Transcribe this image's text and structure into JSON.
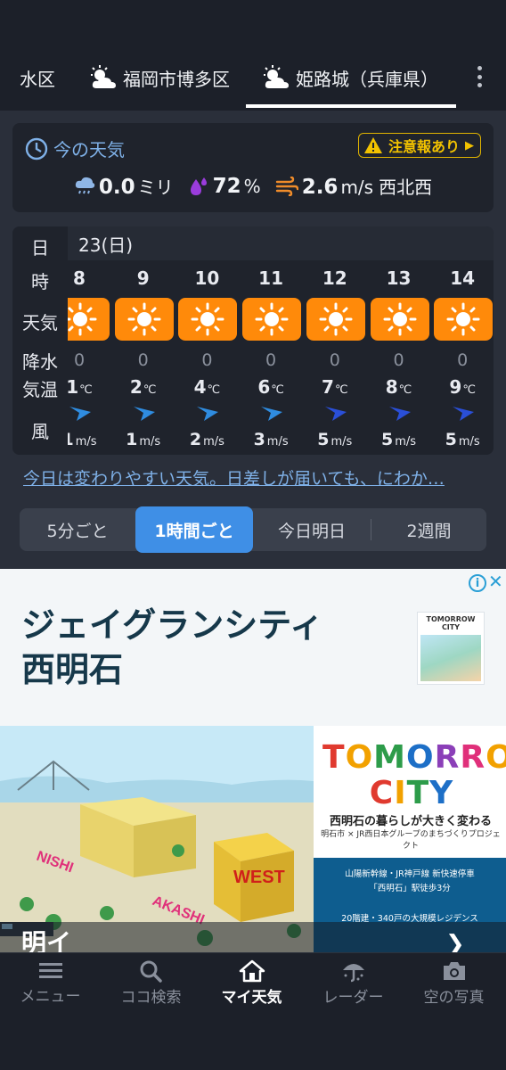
{
  "location_tabs": [
    {
      "label": "水区",
      "has_icon": false
    },
    {
      "label": "福岡市博多区",
      "has_icon": true
    },
    {
      "label": "姫路城（兵庫県）",
      "has_icon": true,
      "active": true
    }
  ],
  "current": {
    "title": "今の天気",
    "alert": "注意報あり",
    "rain_value": "0.0",
    "rain_unit": "ミリ",
    "humidity_value": "72",
    "humidity_unit": "%",
    "wind_value": "2.6",
    "wind_unit": "m/s",
    "wind_dir": "西北西"
  },
  "hourly": {
    "labels": {
      "day": "日",
      "hour": "時",
      "weather": "天気",
      "precip": "降水",
      "temp": "気温",
      "wind": "風"
    },
    "date": "23(日)",
    "temp_unit": "℃",
    "wind_unit": "m/s",
    "columns": [
      {
        "hour": "8",
        "weather": "sunny",
        "precip": "0",
        "temp": "1",
        "wind": "1"
      },
      {
        "hour": "9",
        "weather": "sunny",
        "precip": "0",
        "temp": "2",
        "wind": "1"
      },
      {
        "hour": "10",
        "weather": "sunny",
        "precip": "0",
        "temp": "4",
        "wind": "2"
      },
      {
        "hour": "11",
        "weather": "sunny",
        "precip": "0",
        "temp": "6",
        "wind": "3"
      },
      {
        "hour": "12",
        "weather": "sunny",
        "precip": "0",
        "temp": "7",
        "wind": "5"
      },
      {
        "hour": "13",
        "weather": "sunny",
        "precip": "0",
        "temp": "8",
        "wind": "5"
      },
      {
        "hour": "14",
        "weather": "sunny",
        "precip": "0",
        "temp": "9",
        "wind": "5"
      }
    ]
  },
  "forecast_text": "今日は変わりやすい天気。日差しが届いても、にわか…",
  "interval_tabs": [
    "5分ごと",
    "1時間ごと",
    "今日明日",
    "2週間"
  ],
  "active_interval": "1時間ごと",
  "ad": {
    "headline_1": "ジェイグランシティ",
    "headline_2": "西明石",
    "thumb_title": "TOMORROW CITY",
    "logo_1": "TOMORROW",
    "logo_2": "CITY",
    "sub": "西明石の暮らしが大きく変わる",
    "sub2": "明石市 × JR西日本グループのまちづくりプロジェクト",
    "info_1": "山陽新幹線・JR神戸線 新快速停車",
    "info_2": "「西明石」駅徒歩3分",
    "info_3": "20階建・340戸の大規模レジデンス",
    "cut_text": "明イ"
  },
  "bottom_nav": [
    {
      "label": "メニュー",
      "icon": "menu-icon"
    },
    {
      "label": "ココ検索",
      "icon": "search-icon"
    },
    {
      "label": "マイ天気",
      "icon": "home-icon",
      "active": true
    },
    {
      "label": "レーダー",
      "icon": "umbrella-icon"
    },
    {
      "label": "空の写真",
      "icon": "camera-icon"
    }
  ]
}
